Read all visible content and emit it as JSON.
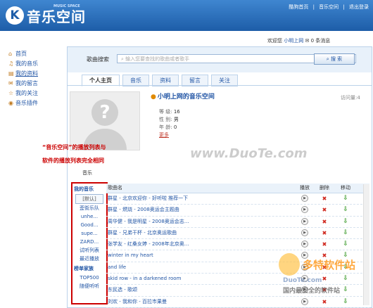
{
  "header": {
    "logo_letter": "K",
    "logo_text": "音乐空间",
    "logo_sub": "MUSIC SPACE",
    "links": [
      "酷狗首页",
      "|",
      "音乐空间",
      "|",
      "退出登录"
    ]
  },
  "welcome": {
    "prefix": "欢迎您",
    "username": "小明上网",
    "messages": "0",
    "messages_text": "条消息"
  },
  "left_nav": [
    {
      "icon": "home-icon",
      "glyph": "⌂",
      "label": "首页"
    },
    {
      "icon": "music-icon",
      "glyph": "♫",
      "label": "我的音乐"
    },
    {
      "icon": "profile-icon",
      "glyph": "▤",
      "label": "我的资料"
    },
    {
      "icon": "message-icon",
      "glyph": "✉",
      "label": "我的留言"
    },
    {
      "icon": "follow-icon",
      "glyph": "☆",
      "label": "我的关注"
    },
    {
      "icon": "plugin-icon",
      "glyph": "◉",
      "label": "音乐插件"
    }
  ],
  "search": {
    "label": "歌曲搜索",
    "placeholder": "输入您要查找的歌曲或者歌手",
    "button": "搜 索"
  },
  "tabs": [
    "个人主页",
    "音乐",
    "资料",
    "留言",
    "关注"
  ],
  "profile": {
    "title": "小明上网的音乐空间",
    "visits_label": "访问量:",
    "visits": "4",
    "fields": [
      {
        "label": "等  级:",
        "value": "16"
      },
      {
        "label": "性  别:",
        "value": "男"
      },
      {
        "label": "年  龄:",
        "value": "0"
      }
    ],
    "more": "更多"
  },
  "watermark": "www.DuoTe.com",
  "annotation": {
    "line1": "“音乐空间”的播放列表与",
    "line2": "软件的播放列表完全相同"
  },
  "music_label": "音乐",
  "playlist": {
    "my_music_title": "我的音乐",
    "my_items": [
      "[默认]",
      "歪街乐队",
      "unhe...",
      "Good...",
      "supe...",
      "ZARD...",
      "试听列表",
      "最近播放"
    ],
    "charts_title": "榜单家族",
    "chart_items": [
      "TOP500",
      "随便听听"
    ]
  },
  "song_table": {
    "headers": {
      "name": "歌曲名",
      "play": "播放",
      "delete": "删除",
      "move": "移动"
    },
    "rows": [
      "群星 - 北京欢迎你 - 好听啦 推荐一下",
      "群星 - 燃烧 - 2008奥运会主题曲",
      "周华健 - 我是明星 - 2008奥运会志...",
      "群星 - 兄弟干杯 - 北京奥运歌曲",
      "张学友 - 红桑女婷 - 2008年北京奥...",
      "winter in my heart",
      "and life",
      "skid row - in a darkened room",
      "东民选 - 歌颂",
      "刘欢 - 我和你 - 百拉市果曼"
    ]
  },
  "site_logo": {
    "brand": "多特软件站",
    "url": "DuoTe.com",
    "slogan": "国内最安全的软件站"
  }
}
